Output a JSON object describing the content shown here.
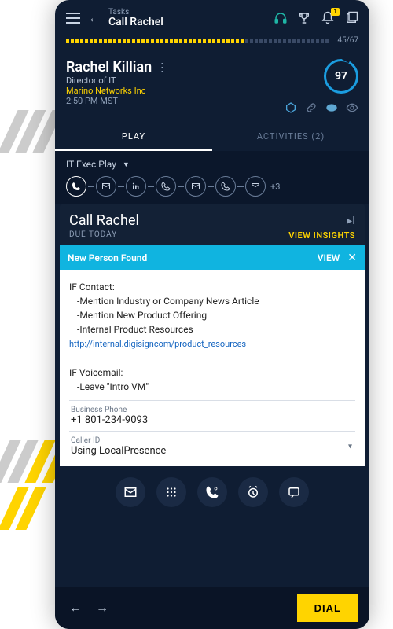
{
  "header": {
    "breadcrumb": "Tasks",
    "title": "Call Rachel",
    "notification_count": "1"
  },
  "progress": {
    "done": 45,
    "total": 67,
    "text": "45/67"
  },
  "contact": {
    "name": "Rachel Killian",
    "title": "Director of IT",
    "company": "Marino Networks Inc",
    "local_time": "2:50 PM MST",
    "score": "97"
  },
  "tabs": {
    "play": "PLAY",
    "activities": "ACTIVITIES (2)"
  },
  "play": {
    "selected": "IT Exec Play",
    "more_steps": "+3"
  },
  "task": {
    "title": "Call Rachel",
    "due": "DUE TODAY",
    "insights_label": "VIEW INSIGHTS"
  },
  "alert": {
    "title": "New Person Found",
    "view_label": "VIEW"
  },
  "notes": {
    "if_contact_label": "IF Contact:",
    "bullets": [
      "-Mention Industry or Company News Article",
      "-Mention New Product Offering",
      "-Internal Product Resources"
    ],
    "link": "http://internal.digisigncom/product_resources",
    "if_voicemail_label": "IF Voicemail:",
    "vm_bullet": "-Leave \"Intro VM\""
  },
  "fields": {
    "phone_label": "Business Phone",
    "phone_value": "+1 801-234-9093",
    "caller_id_label": "Caller ID",
    "caller_id_value": "Using LocalPresence"
  },
  "bottom": {
    "dial": "DIAL"
  }
}
